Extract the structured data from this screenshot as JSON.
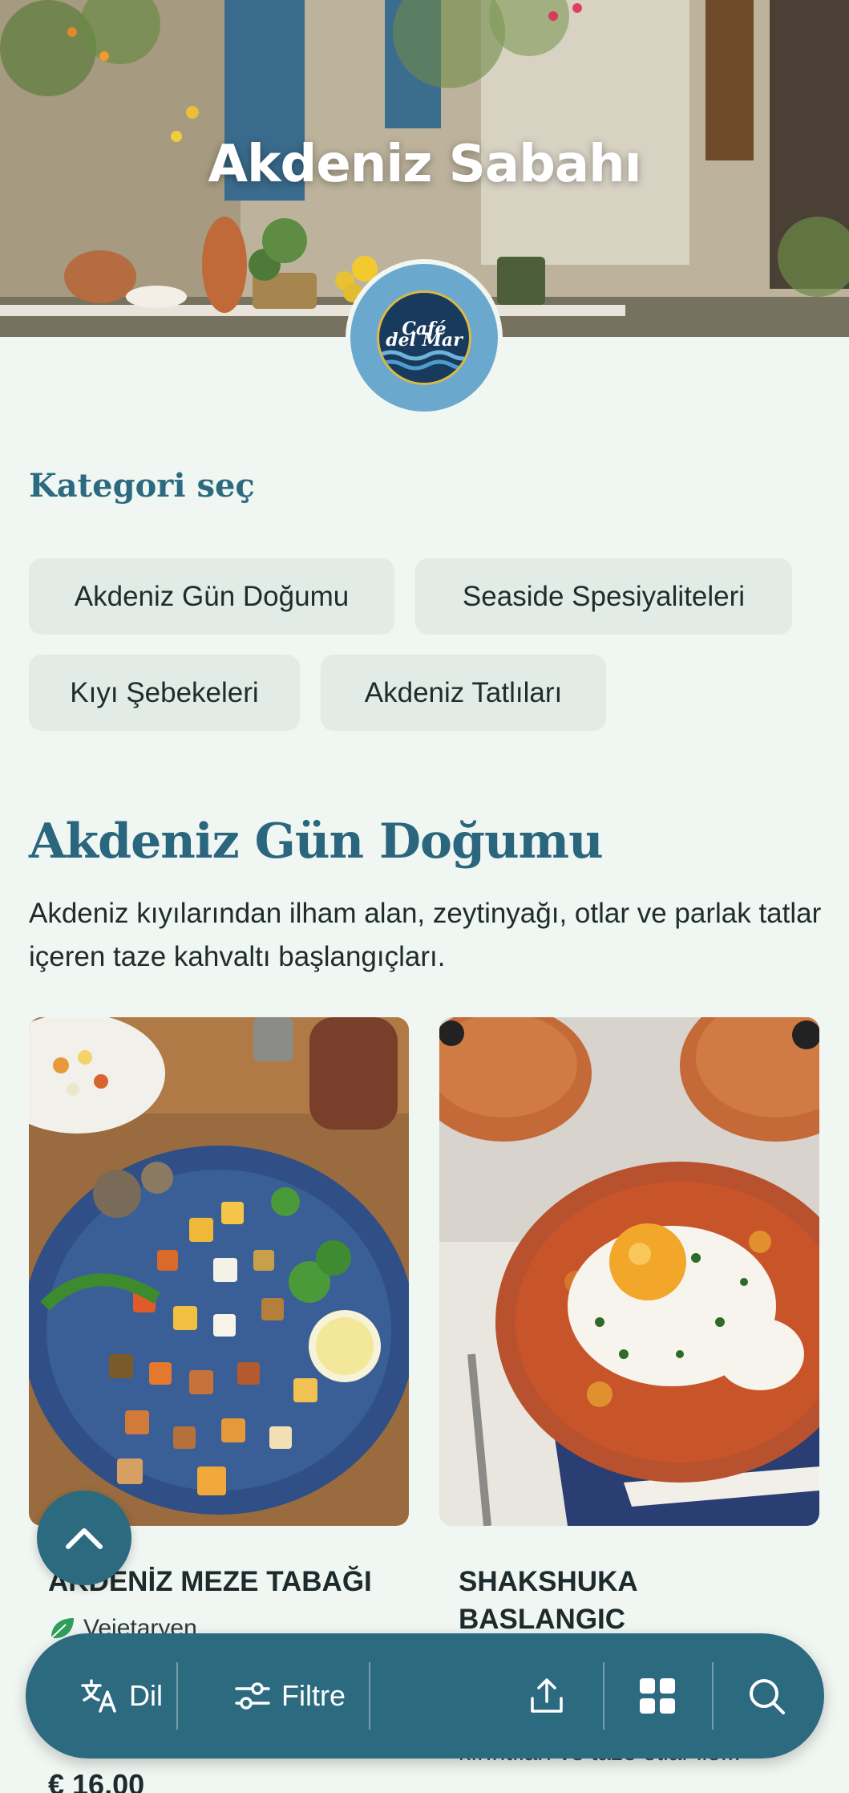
{
  "header": {
    "title": "Akdeniz Sabahı",
    "logo_text_line1": "Café",
    "logo_text_line2": "del Mar"
  },
  "categories": {
    "label": "Kategori seç",
    "items": [
      "Akdeniz Gün Doğumu",
      "Seaside Spesiyaliteleri",
      "Kıyı Şebekeleri",
      "Akdeniz Tatlıları"
    ]
  },
  "active_category": {
    "title": "Akdeniz Gün Doğumu",
    "description": "Akdeniz kıyılarından ilham alan, zeytinyağı, otlar ve parlak tatlar içeren taze kahvaltı başlangıçları."
  },
  "products": [
    {
      "name": "AKDENİZ MEZE TABAĞI",
      "tag": "Vejetaryen",
      "price": "€ 16,00",
      "image_icon": "meze-platter-photo"
    },
    {
      "name": "SHAKSHUKA BASLANGIC",
      "description": "kırıntıları ve taze otlar ile...",
      "image_icon": "shakshuka-photo"
    }
  ],
  "toolbar": {
    "language_label": "Dil",
    "filter_label": "Filtre",
    "language_icon": "translate-icon",
    "filter_icon": "sliders-icon",
    "share_icon": "share-icon",
    "grid_icon": "grid-view-icon",
    "search_icon": "search-icon"
  },
  "colors": {
    "primary": "#2c6a80",
    "background": "#f0f6f2",
    "chip_bg": "#e2ebe6",
    "vegetarian_green": "#2e9e5b"
  }
}
